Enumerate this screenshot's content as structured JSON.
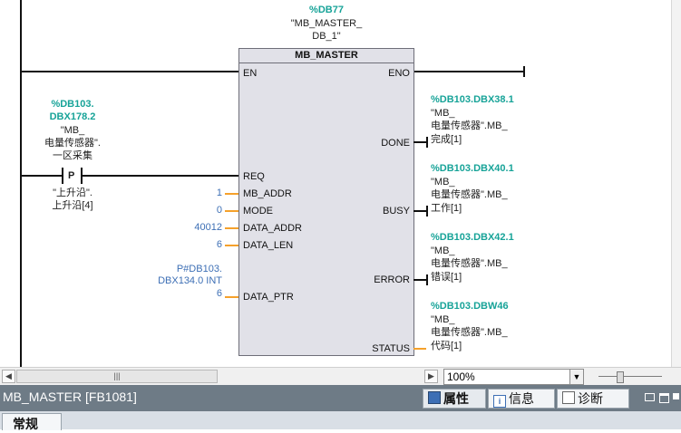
{
  "instance_db": {
    "address": "%DB77",
    "name_line1": "\"MB_MASTER_",
    "name_line2": "DB_1\""
  },
  "block": {
    "type": "MB_MASTER",
    "inputs": {
      "en": "EN",
      "req": "REQ",
      "mb_addr": "MB_ADDR",
      "mode": "MODE",
      "data_addr": "DATA_ADDR",
      "data_len": "DATA_LEN",
      "data_ptr": "DATA_PTR"
    },
    "outputs": {
      "eno": "ENO",
      "done": "DONE",
      "busy": "BUSY",
      "error": "ERROR",
      "status": "STATUS"
    }
  },
  "contact": {
    "address_line1": "%DB103.",
    "address_line2": "DBX178.2",
    "name_line1": "\"MB_",
    "name_line2": "电量传感器\".",
    "name_line3": "一区采集",
    "symbol": "P",
    "edge_line1": "\"上升沿\".",
    "edge_line2": "上升沿[4]"
  },
  "params": {
    "mb_addr": "1",
    "mode": "0",
    "data_addr": "40012",
    "data_len": "6",
    "data_ptr_line1": "P#DB103.",
    "data_ptr_line2": "DBX134.0 INT",
    "data_ptr_line3": "6"
  },
  "outputs_vars": {
    "done": {
      "address": "%DB103.DBX38.1",
      "l1": "\"MB_",
      "l2": "电量传感器\".MB_",
      "l3": "完成[1]"
    },
    "busy": {
      "address": "%DB103.DBX40.1",
      "l1": "\"MB_",
      "l2": "电量传感器\".MB_",
      "l3": "工作[1]"
    },
    "error": {
      "address": "%DB103.DBX42.1",
      "l1": "\"MB_",
      "l2": "电量传感器\".MB_",
      "l3": "错误[1]"
    },
    "status": {
      "address": "%DB103.DBW46",
      "l1": "\"MB_",
      "l2": "电量传感器\".MB_",
      "l3": "代码[1]"
    }
  },
  "scrollbar": {
    "left_arrow": "◀",
    "right_arrow": "▶",
    "thumb_grip": "|||",
    "zoom": "100%",
    "zoom_arrow": "▼"
  },
  "inspector": {
    "title": "MB_MASTER [FB1081]",
    "tabs": [
      {
        "label": "属性",
        "icon": "properties-icon"
      },
      {
        "label": "信息",
        "icon": "info-icon"
      },
      {
        "label": "诊断",
        "icon": "diagnostics-icon"
      }
    ],
    "subtab": "常规"
  }
}
